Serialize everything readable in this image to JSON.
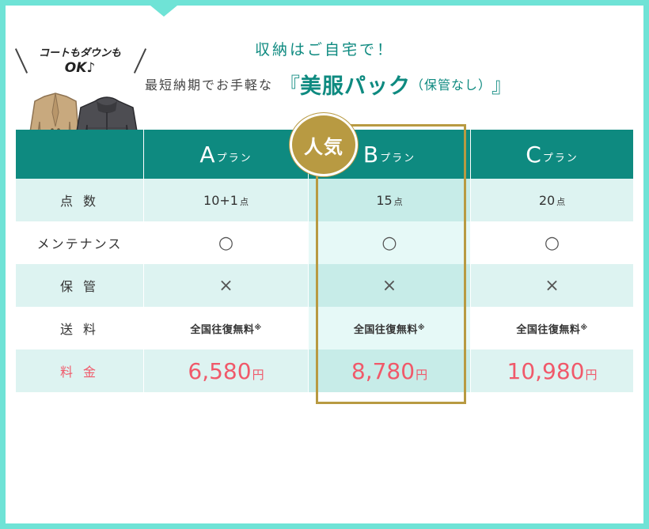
{
  "header": {
    "subtitle": "収納はご自宅で！",
    "tagline_prefix": "最短納期でお手軽な",
    "bracket_open": "『",
    "product_name": "美服パック",
    "product_note": "（保管なし）",
    "bracket_close": "』"
  },
  "promo": {
    "line1": "コートもダウンも",
    "line2": "OK♪",
    "icons": [
      "beige-coat-icon",
      "down-jacket-icon"
    ]
  },
  "badge": {
    "label": "人気"
  },
  "plans": [
    {
      "letter": "A",
      "suffix": "プラン"
    },
    {
      "letter": "B",
      "suffix": "プラン"
    },
    {
      "letter": "C",
      "suffix": "プラン"
    }
  ],
  "rows": {
    "count": {
      "label": "点 数",
      "values": [
        {
          "num": "10+1",
          "unit": "点"
        },
        {
          "num": "15",
          "unit": "点"
        },
        {
          "num": "20",
          "unit": "点"
        }
      ]
    },
    "maintenance": {
      "label": "メンテナンス",
      "values": [
        "○",
        "○",
        "○"
      ]
    },
    "storage": {
      "label": "保 管",
      "values": [
        "×",
        "×",
        "×"
      ]
    },
    "shipping": {
      "label": "送 料",
      "values": [
        {
          "text": "全国往復無料",
          "mark": "※"
        },
        {
          "text": "全国往復無料",
          "mark": "※"
        },
        {
          "text": "全国往復無料",
          "mark": "※"
        }
      ]
    },
    "price": {
      "label": "料 金",
      "values": [
        {
          "amount": "6,580",
          "unit": "円"
        },
        {
          "amount": "8,780",
          "unit": "円"
        },
        {
          "amount": "10,980",
          "unit": "円"
        }
      ]
    }
  },
  "colors": {
    "teal": "#0e8a80",
    "border": "#6fe3d6",
    "gold": "#b89a42",
    "price_red": "#f0596a"
  }
}
